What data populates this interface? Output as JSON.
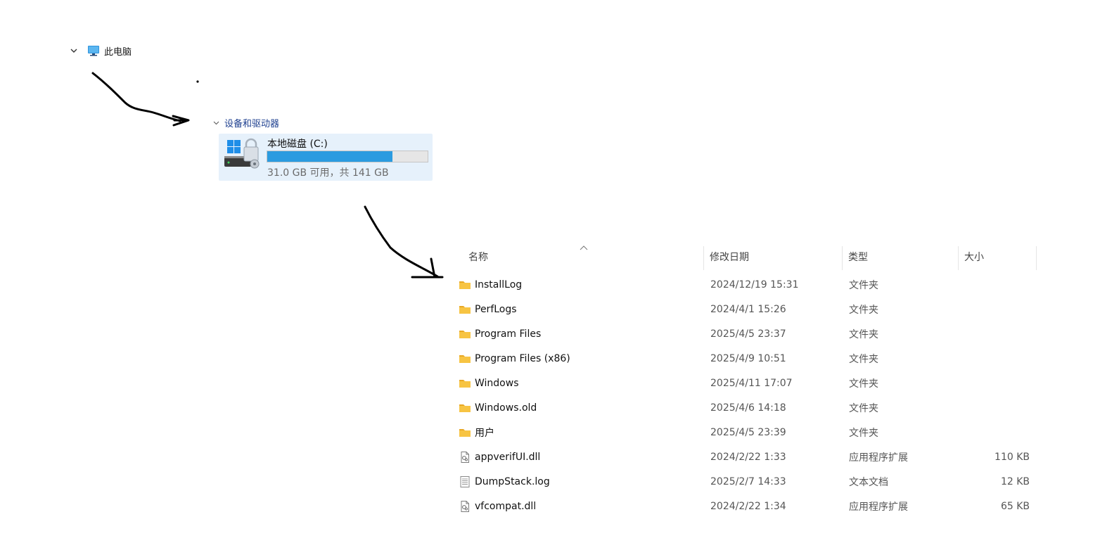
{
  "tree": {
    "root_label": "此电脑",
    "chevron_icon": "chevron-down-icon",
    "pc_icon": "computer-monitor-icon"
  },
  "group": {
    "label": "设备和驱动器"
  },
  "drive": {
    "name": "本地磁盘 (C:)",
    "space_text": "31.0 GB 可用，共 141 GB",
    "used_fraction": 0.78,
    "icon": "windows-drive-lock-icon",
    "bar_color": "#2b9be0"
  },
  "file_list": {
    "columns": [
      {
        "key": "name",
        "label": "名称"
      },
      {
        "key": "date",
        "label": "修改日期"
      },
      {
        "key": "type",
        "label": "类型"
      },
      {
        "key": "size",
        "label": "大小"
      }
    ],
    "sort_indicator": "sort-ascending-icon",
    "rows": [
      {
        "icon": "folder-icon",
        "name": "InstallLog",
        "date": "2024/12/19 15:31",
        "type": "文件夹",
        "size": ""
      },
      {
        "icon": "folder-icon",
        "name": "PerfLogs",
        "date": "2024/4/1 15:26",
        "type": "文件夹",
        "size": ""
      },
      {
        "icon": "folder-icon",
        "name": "Program Files",
        "date": "2025/4/5 23:37",
        "type": "文件夹",
        "size": ""
      },
      {
        "icon": "folder-icon",
        "name": "Program Files (x86)",
        "date": "2025/4/9 10:51",
        "type": "文件夹",
        "size": ""
      },
      {
        "icon": "folder-icon",
        "name": "Windows",
        "date": "2025/4/11 17:07",
        "type": "文件夹",
        "size": ""
      },
      {
        "icon": "folder-icon",
        "name": "Windows.old",
        "date": "2025/4/6 14:18",
        "type": "文件夹",
        "size": ""
      },
      {
        "icon": "folder-icon",
        "name": "用户",
        "date": "2025/4/5 23:39",
        "type": "文件夹",
        "size": ""
      },
      {
        "icon": "dll-file-icon",
        "name": "appverifUI.dll",
        "date": "2024/2/22 1:33",
        "type": "应用程序扩展",
        "size": "110 KB"
      },
      {
        "icon": "text-file-icon",
        "name": "DumpStack.log",
        "date": "2025/2/7 14:33",
        "type": "文本文档",
        "size": "12 KB"
      },
      {
        "icon": "dll-file-icon",
        "name": "vfcompat.dll",
        "date": "2024/2/22 1:34",
        "type": "应用程序扩展",
        "size": "65 KB"
      }
    ]
  },
  "colors": {
    "group_header": "#1d3f8f",
    "tile_background": "#e6f1fb",
    "folder": "#f7c443"
  }
}
